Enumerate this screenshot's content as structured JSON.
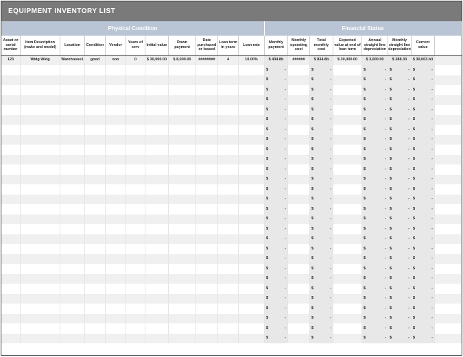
{
  "title": "EQUIPMENT INVENTORY LIST",
  "groups": {
    "physical": "Physical Condition",
    "financial": "Financial Status"
  },
  "headers": [
    "Asset or serial number",
    "Item Description (make and model)",
    "Location",
    "Condition",
    "Vendor",
    "Years of serv",
    "Initial value",
    "Down payment",
    "Date purchased or leased",
    "Loan term in years",
    "Loan rate",
    "Monthly payment",
    "Monthly operating cost",
    "Total monthly cost",
    "Expected value at end of loan term",
    "Annual straight line depreciation",
    "Monthly straight line depreciation",
    "Current value"
  ],
  "row0": {
    "c0": "123",
    "c1": "Widg Widg",
    "c2": "Warehouse1",
    "c3": "good",
    "c4": "ooo",
    "c5": "0",
    "c6": "$ 30,000.00",
    "c7": "$ 8,000.00",
    "c8": "########",
    "c9": "4",
    "c10": "10.00%",
    "c11": "$ 434.8b",
    "c12": "######",
    "c13": "$ 834.8b",
    "c14": "$ 30,000.00",
    "c15": "$ 3,000.00",
    "c16": "$  388.33",
    "c17": "$ 30,003.b3"
  },
  "dash": "-",
  "bullet": "$",
  "blank_rows": 28
}
